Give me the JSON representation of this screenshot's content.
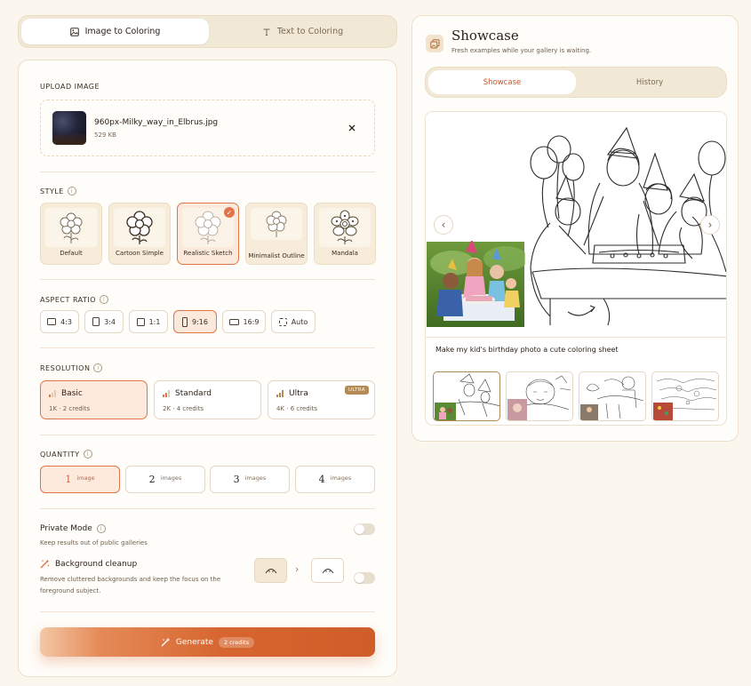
{
  "mode_tabs": {
    "image_to_coloring": "Image to Coloring",
    "text_to_coloring": "Text to Coloring"
  },
  "upload": {
    "label": "UPLOAD IMAGE",
    "file_name": "960px-Milky_way_in_Elbrus.jpg",
    "file_size": "529 KB"
  },
  "style": {
    "label": "STYLE",
    "options": [
      {
        "label": "Default"
      },
      {
        "label": "Cartoon Simple"
      },
      {
        "label": "Realistic Sketch",
        "selected": true
      },
      {
        "label": "Minimalist Outline"
      },
      {
        "label": "Mandala"
      }
    ]
  },
  "aspect_ratio": {
    "label": "ASPECT RATIO",
    "options": [
      "4:3",
      "3:4",
      "1:1",
      "9:16",
      "16:9",
      "Auto"
    ],
    "selected": "9:16"
  },
  "resolution": {
    "label": "RESOLUTION",
    "options": [
      {
        "title": "Basic",
        "sub": "1K · 2 credits",
        "selected": true
      },
      {
        "title": "Standard",
        "sub": "2K · 4 credits"
      },
      {
        "title": "Ultra",
        "sub": "4K · 6 credits",
        "tag": "ULTRA"
      }
    ]
  },
  "quantity": {
    "label": "QUANTITY",
    "options": [
      {
        "n": "1",
        "unit": "image",
        "selected": true
      },
      {
        "n": "2",
        "unit": "images"
      },
      {
        "n": "3",
        "unit": "images"
      },
      {
        "n": "4",
        "unit": "images"
      }
    ]
  },
  "private_mode": {
    "title": "Private Mode",
    "desc": "Keep results out of public galleries"
  },
  "bg_cleanup": {
    "title": "Background cleanup",
    "desc": "Remove cluttered backgrounds and keep the focus on the foreground subject."
  },
  "generate": {
    "label": "Generate",
    "credits": "2 credits"
  },
  "showcase": {
    "title": "Showcase",
    "subtitle": "Fresh examples while your gallery is waiting.",
    "tabs": [
      "Showcase",
      "History"
    ],
    "caption": "Make my kid's birthday photo a cute coloring sheet"
  },
  "colors": {
    "accent": "#e0744a",
    "background": "#fbf6ee",
    "panel": "#fffdf9"
  }
}
